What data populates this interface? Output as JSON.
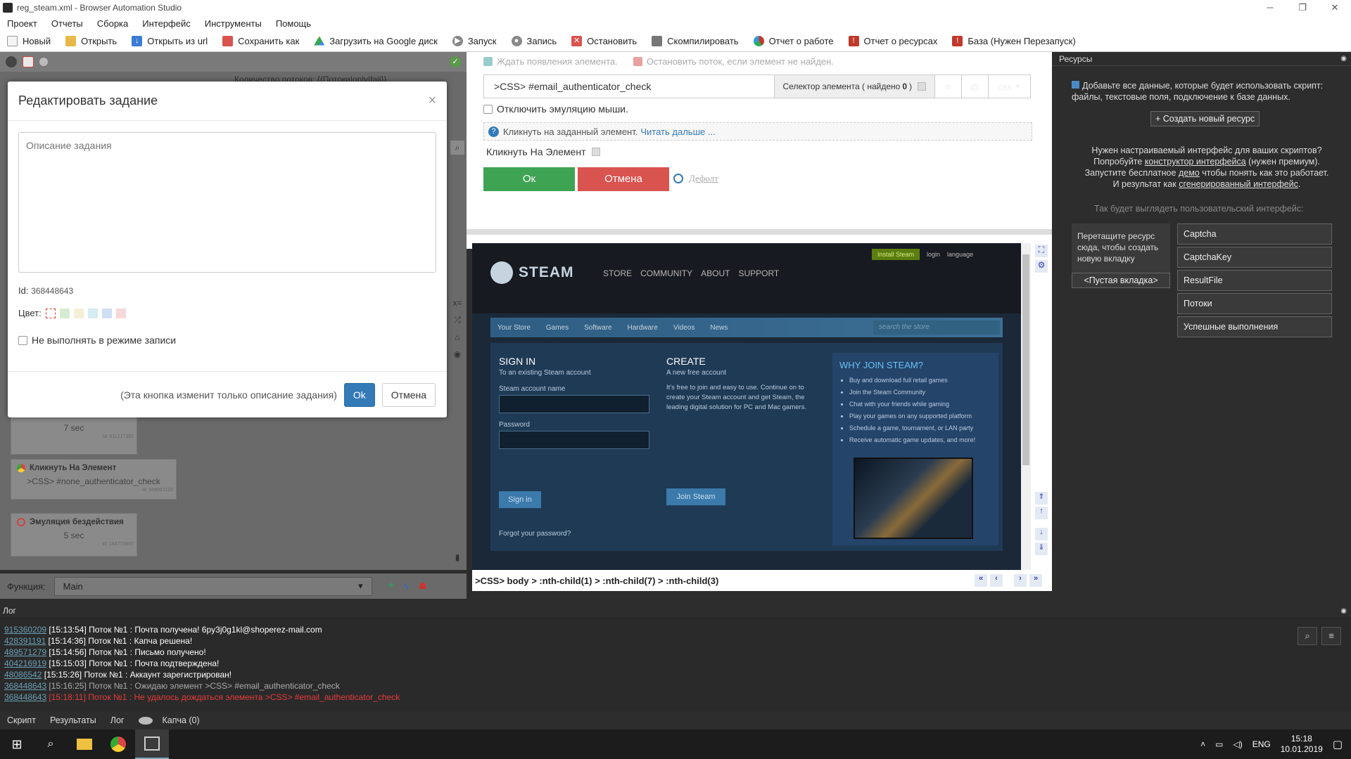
{
  "window": {
    "title": "reg_steam.xml - Browser Automation Studio"
  },
  "menu": [
    "Проект",
    "Отчеты",
    "Сборка",
    "Интерфейс",
    "Инструменты",
    "Помощь"
  ],
  "toolbar": [
    {
      "label": "Новый",
      "icon": "new-file-icon",
      "color": "#f0f0f0"
    },
    {
      "label": "Открыть",
      "icon": "folder-icon",
      "color": "#e8b84a"
    },
    {
      "label": "Открыть из url",
      "icon": "download-arrow-icon",
      "color": "#3b7bd4"
    },
    {
      "label": "Сохранить как",
      "icon": "save-icon",
      "color": "#d9534f"
    },
    {
      "label": "Загрузить на Google диск",
      "icon": "google-drive-icon",
      "color": "#34a853"
    },
    {
      "label": "Запуск",
      "icon": "play-icon",
      "color": "#888888"
    },
    {
      "label": "Запись",
      "icon": "record-icon",
      "color": "#888888"
    },
    {
      "label": "Остановить",
      "icon": "stop-icon",
      "color": "#d9534f"
    },
    {
      "label": "Скомпилировать",
      "icon": "compile-icon",
      "color": "#777777"
    },
    {
      "label": "Отчет о работе",
      "icon": "report-chart-icon",
      "color": "#c0392b"
    },
    {
      "label": "Отчет о ресурсах",
      "icon": "warning-report-icon",
      "color": "#c0392b"
    },
    {
      "label": "База (Нужен Перезапуск)",
      "icon": "database-icon",
      "color": "#c0392b"
    }
  ],
  "left": {
    "threads_label": "Количество потоков: {{Потоки|only|fail}}",
    "nodes": [
      {
        "title": "",
        "body": "7 sec",
        "id": "Id: 611217382"
      },
      {
        "title": "Кликнуть На Элемент",
        "body": ">CSS> #none_authenticator_check",
        "id": "Id: 948081120"
      },
      {
        "title": "Эмуляция бездействия",
        "body": "5 sec",
        "id": "Id: 184773897"
      }
    ],
    "function_label": "Функция:",
    "function_value": "Main"
  },
  "modal": {
    "title": "Редактировать задание",
    "close": "×",
    "placeholder": "Описание задания",
    "id_label": "Id:",
    "id_value": "368448643",
    "color_label": "Цвет:",
    "colors": [
      "#ffffff",
      "#d6ecd2",
      "#f5efd6",
      "#d4ecf2",
      "#cfe0f2",
      "#f6d8d8"
    ],
    "no_record_label": "Не выполнять в режиме записи",
    "note": "(Эта кнопка изменит только описание задания)",
    "ok": "Ok",
    "cancel": "Отмена"
  },
  "editor": {
    "wait_label": "Ждать появления элемента.",
    "stop_label": "Остановить поток, если элемент не найден.",
    "selector_value": ">CSS> #email_authenticator_check",
    "selector_count_label": "Селектор элемента ( найдено ",
    "selector_count": "0",
    "selector_count_close": " )",
    "selector_type": "css",
    "disable_mouse": "Отключить эмуляцию мыши.",
    "hint": "Кликнуть на заданный элемент.",
    "hint_link": "Читать дальше ...",
    "action_name": "Кликнуть На Элемент",
    "ok": "Ок",
    "cancel": "Отмена",
    "default": "Дефолт"
  },
  "steam": {
    "logo": "STEAM",
    "install": "Install Steam",
    "login": "login",
    "language": "language",
    "nav": [
      "STORE",
      "COMMUNITY",
      "ABOUT",
      "SUPPORT"
    ],
    "subnav": [
      "Your Store",
      "Games",
      "Software",
      "Hardware",
      "Videos",
      "News"
    ],
    "search_placeholder": "search the store",
    "signin_title": "SIGN IN",
    "signin_sub": "To an existing Steam account",
    "account_label": "Steam account name",
    "password_label": "Password",
    "signin_btn": "Sign in",
    "forgot": "Forgot your password?",
    "create_title": "CREATE",
    "create_sub": "A new free account",
    "create_text": "It's free to join and easy to use. Continue on to create your Steam account and get Steam, the leading digital solution for PC and Mac gamers.",
    "join_btn": "Join Steam",
    "why_title": "WHY JOIN STEAM?",
    "why_items": [
      "Buy and download full retail games",
      "Join the Steam Community",
      "Chat with your friends while gaming",
      "Play your games on any supported platform",
      "Schedule a game, tournament, or LAN party",
      "Receive automatic game updates, and more!"
    ]
  },
  "browser_path": ">CSS> body > :nth-child(1) > :nth-child(7) > :nth-child(3)",
  "resources": {
    "header": "Ресурсы",
    "info": "Добавьте все данные, которые будет использовать скрипт: файлы, текстовые поля, подключение к базе данных.",
    "create_btn": "+ Создать новый ресурс",
    "custom_1": "Нужен настраиваемый интерфейс для ваших скриптов?",
    "custom_2a": "Попробуйте ",
    "custom_2_link": "конструктор интерфейса",
    "custom_2b": " (нужен премиум).",
    "custom_3a": "Запустите бесплатное ",
    "custom_3_link": "демо",
    "custom_3b": " чтобы понять как это работает.",
    "custom_4a": "И результат как ",
    "custom_4_link": "сгенерированный интерфейс",
    "custom_4b": ".",
    "preview_label": "Так будет выглядеть пользовательский интерфейс:",
    "drag_hint": "Перетащите ресурс сюда, чтобы создать новую вкладку",
    "empty_tab": "<Пустая вкладка>",
    "items": [
      "Captcha",
      "CaptchaKey",
      "ResultFile",
      "Потоки",
      "Успешные выполнения"
    ]
  },
  "log": {
    "header": "Лог",
    "lines": [
      {
        "id": "915360209",
        "text": "[15:13:54] Поток №1 : Почта получена! 6py3j0g1kl@shoperez-mail.com",
        "color": "#ffffff"
      },
      {
        "id": "428391191",
        "text": "[15:14:36] Поток №1 : Капча решена!",
        "color": "#ffffff"
      },
      {
        "id": "489571279",
        "text": "[15:14:56] Поток №1 : Письмо получено!",
        "color": "#ffffff"
      },
      {
        "id": "404216919",
        "text": "[15:15:03] Поток №1 : Почта подтверждена!",
        "color": "#ffffff"
      },
      {
        "id": "48086542",
        "text": "[15:15:26] Поток №1 : Аккаунт зарегистрирован!",
        "color": "#ffffff"
      },
      {
        "id": "368448643",
        "text": "[15:16:25] Поток №1 : Ожидаю элемент >CSS> #email_authenticator_check",
        "color": "#aaaaaa"
      },
      {
        "id": "368448643",
        "text": "[15:18:11] Поток №1 : Не удалось дождаться элемента >CSS> #email_authenticator_check",
        "color": "#e83a3a"
      }
    ]
  },
  "bottom_tabs": [
    "Скрипт",
    "Результаты",
    "Лог",
    "Капча (0)"
  ],
  "taskbar": {
    "lang": "ENG",
    "time": "15:18",
    "date": "10.01.2019"
  }
}
